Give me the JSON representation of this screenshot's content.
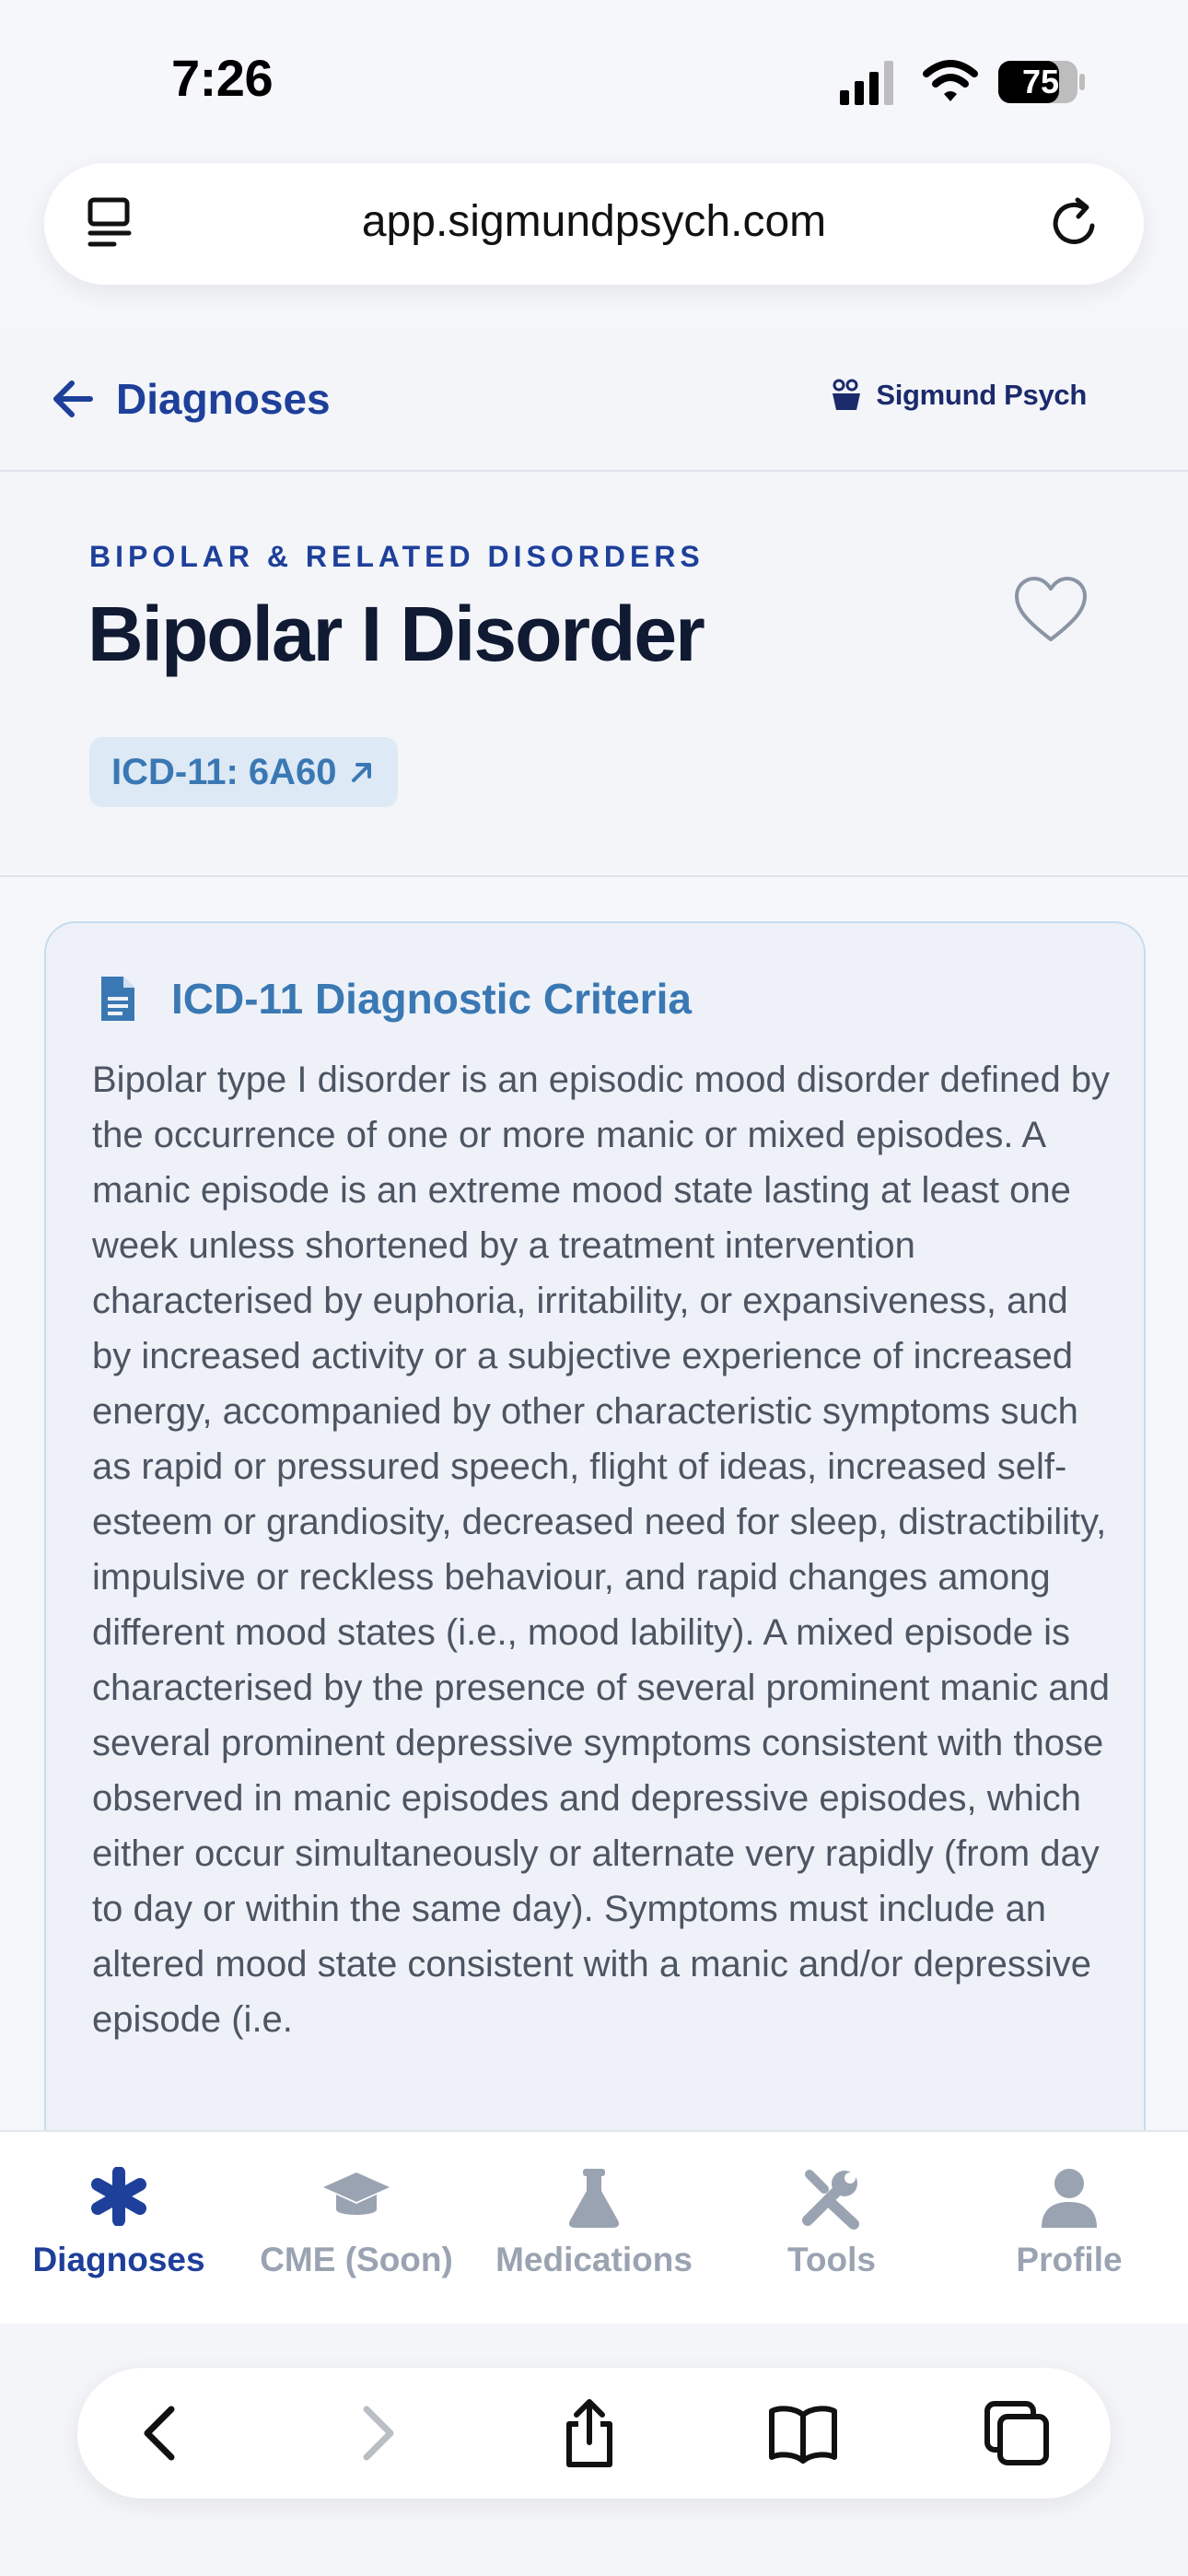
{
  "status": {
    "time": "7:26",
    "battery": "75"
  },
  "browser": {
    "url": "app.sigmundpsych.com"
  },
  "nav": {
    "back_label": "Diagnoses",
    "brand": "Sigmund Psych"
  },
  "header": {
    "category": "BIPOLAR & RELATED DISORDERS",
    "title": "Bipolar I Disorder",
    "icd_chip": "ICD-11: 6A60",
    "icd_chip_icon": "arrow-up-right-icon"
  },
  "criteria": {
    "title": "ICD-11 Diagnostic Criteria",
    "icon": "document-icon",
    "body": "Bipolar type I disorder is an episodic mood disorder defined by the occurrence of one or more manic or mixed episodes. A manic episode is an extreme mood state lasting at least one week unless shortened by a treatment intervention characterised by euphoria, irritability, or expansiveness, and by increased activity or a subjective experience of increased energy, accompanied by other characteristic symptoms such as rapid or pressured speech, flight of ideas, increased self-esteem or grandiosity, decreased need for sleep, distractibility, impulsive or reckless behaviour, and rapid changes among different mood states (i.e., mood lability). A mixed episode is characterised by the presence of several prominent manic and several prominent depressive symptoms consistent with those observed in manic episodes and depressive episodes, which either occur simultaneously or alternate very rapidly (from day to day or within the same day). Symptoms must include an altered mood state consistent with a manic and/or depressive episode (i.e."
  },
  "tabs": [
    {
      "label": "Diagnoses",
      "icon": "asterisk-icon",
      "active": true
    },
    {
      "label": "CME (Soon)",
      "icon": "graduation-cap-icon",
      "active": false
    },
    {
      "label": "Medications",
      "icon": "flask-icon",
      "active": false
    },
    {
      "label": "Tools",
      "icon": "tools-icon",
      "active": false
    },
    {
      "label": "Profile",
      "icon": "person-icon",
      "active": false
    }
  ],
  "colors": {
    "accent": "#1e3f9a",
    "link_blue": "#3a78b4",
    "inactive": "#9aa3b1"
  }
}
